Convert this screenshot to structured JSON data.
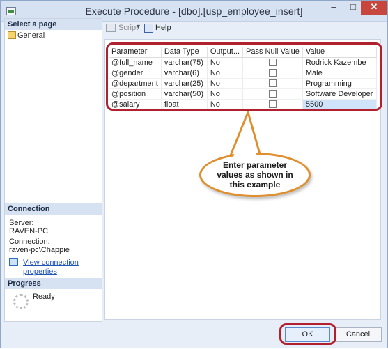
{
  "window": {
    "title": "Execute Procedure - [dbo].[usp_employee_insert]",
    "controls": {
      "minimize": "–",
      "maximize": "□",
      "close": "✕"
    }
  },
  "left_pane": {
    "select_page_header": "Select a page",
    "pages": [
      {
        "label": "General",
        "icon": "page-icon"
      }
    ],
    "connection_header": "Connection",
    "server_label": "Server:",
    "server_value": "RAVEN-PC",
    "connection_label": "Connection:",
    "connection_value": "raven-pc\\Chappie",
    "view_link": "View connection properties",
    "progress_header": "Progress",
    "progress_status": "Ready"
  },
  "toolbar": {
    "script_label": "Script",
    "help_label": "Help"
  },
  "grid": {
    "columns": [
      "Parameter",
      "Data Type",
      "Output...",
      "Pass Null Value",
      "Value"
    ],
    "rows": [
      {
        "parameter": "@full_name",
        "data_type": "varchar(75)",
        "output": "No",
        "pass_null": false,
        "value": "Rodrick Kazembe"
      },
      {
        "parameter": "@gender",
        "data_type": "varchar(6)",
        "output": "No",
        "pass_null": false,
        "value": "Male"
      },
      {
        "parameter": "@department",
        "data_type": "varchar(25)",
        "output": "No",
        "pass_null": false,
        "value": "Programming"
      },
      {
        "parameter": "@position",
        "data_type": "varchar(50)",
        "output": "No",
        "pass_null": false,
        "value": "Software Developer"
      },
      {
        "parameter": "@salary",
        "data_type": "float",
        "output": "No",
        "pass_null": false,
        "value": "5500"
      }
    ]
  },
  "callout": {
    "text": "Enter parameter values as shown in this example"
  },
  "buttons": {
    "ok": "OK",
    "cancel": "Cancel"
  },
  "colors": {
    "highlight_border": "#b0202f",
    "callout_border": "#e08f2e",
    "section_header": "#d6e1f1"
  }
}
